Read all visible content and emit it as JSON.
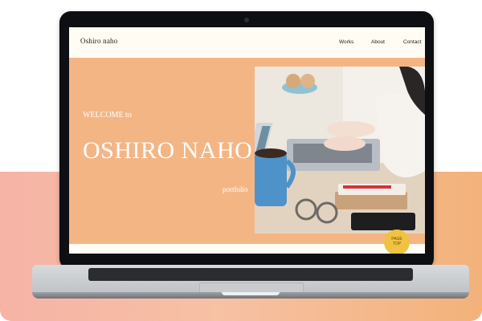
{
  "site": {
    "logo": "Oshiro naho",
    "nav": [
      {
        "label": "Works"
      },
      {
        "label": "About"
      },
      {
        "label": "Contact"
      }
    ]
  },
  "hero": {
    "welcome": "WELCOME to",
    "name": "OSHIRO NAHO",
    "tagline": "portfolio"
  },
  "page_top": {
    "line1": "PAGE",
    "line2": "TOP"
  },
  "colors": {
    "hero_background": "#f4b585",
    "nav_background": "#fffcf3",
    "page_top_button": "#f0c242",
    "backdrop_gradient": [
      "#f6b3a6",
      "#f3b27a"
    ]
  }
}
